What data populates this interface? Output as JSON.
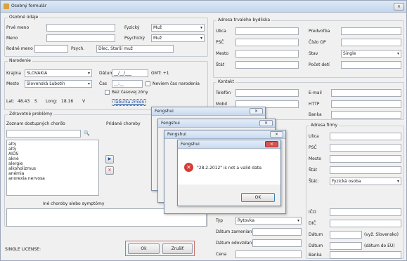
{
  "window": {
    "title": "Osobný formulár",
    "close": "×"
  },
  "left": {
    "personal": {
      "title": "Osobné údaje",
      "first_name": "Prvé meno",
      "last_name": "Meno",
      "maiden": "Rodné meno",
      "psych": "Psych.",
      "physical": {
        "label": "Fyzický",
        "value": "Muž"
      },
      "psychical": {
        "label": "Psychický",
        "value": "Muž"
      },
      "birth_name_field": "Dlec, Starší muž"
    },
    "birth": {
      "title": "Narodenie",
      "country": {
        "label": "Krajina",
        "value": "SLOVAKIA"
      },
      "date": {
        "label": "Dátum",
        "value": "__/__/___",
        "gmt": "GMT: +1"
      },
      "town": {
        "label": "Mesto",
        "value": "Slovenská Ľubotín"
      },
      "time": {
        "label": "Čas",
        "value": "__:__"
      },
      "lat": {
        "label": "Lat:",
        "value": "48.43"
      },
      "lat_dir": "S",
      "long": {
        "label": "Long:",
        "value": "18.16"
      },
      "long_dir": "V",
      "chk1": "Neviem čas narodenia",
      "chk2": "Bez časovej zóny",
      "link": "Tabuľka zmien"
    },
    "health": {
      "title": "Zdravotné problémy",
      "list_label": "Zoznam dostupných chorôb",
      "add_label": "Pridané choroby",
      "search_glyph": "🔍",
      "items": [
        "alty",
        "alty",
        "AIDS",
        "akné",
        "alergie",
        "alkoholizmus",
        "anémia",
        "anorexia nervosa"
      ],
      "symptoms": "Iné choroby alebo symptómy"
    },
    "footer_text": "SINGLE LICENSE:",
    "ok": "Ok",
    "cancel": "Zrušiť"
  },
  "right": {
    "address": {
      "title": "Adresa trvalého bydliska",
      "street": "Ulica",
      "zip": "PSČ",
      "city": "Mesto",
      "state": "Štát",
      "phone_prefix": "Predvoľba",
      "op": "Číslo OP",
      "status": {
        "label": "Stav",
        "value": "Single"
      },
      "children": "Počet detí"
    },
    "contact": {
      "title": "Kontakt",
      "tel": "Telefón",
      "mobile": "Mobil",
      "email": "E-mail",
      "http": "HTTP",
      "bank": "Banka"
    },
    "company": {
      "title": "Adresa firmy",
      "street": "Ulica",
      "zip": "PSČ",
      "city": "Mesto",
      "state": "Štát",
      "state2": {
        "label": "Štát:",
        "value": "Fyzická osoba"
      },
      "ico": "IČO",
      "dic": "DIČ",
      "dates": "Dátum",
      "expiry": "Dátum",
      "bank": "Banka",
      "note1": "(vyž. Slovensko)",
      "note2": "(dátum do EÚ)"
    },
    "doc": {
      "type": {
        "label": "Typ",
        "value": "Rytovka"
      },
      "issue": "Dátum zameniania",
      "valid": "Dátum odovzdania",
      "price": "Cena"
    }
  },
  "dialogs": [
    {
      "title": "Fengshui"
    },
    {
      "title": "Fengshui"
    },
    {
      "title": "Fengshui"
    },
    {
      "title": "Fengshui",
      "message": "\"28.2.2012\" is not a valid date.",
      "ok": "OK"
    }
  ]
}
